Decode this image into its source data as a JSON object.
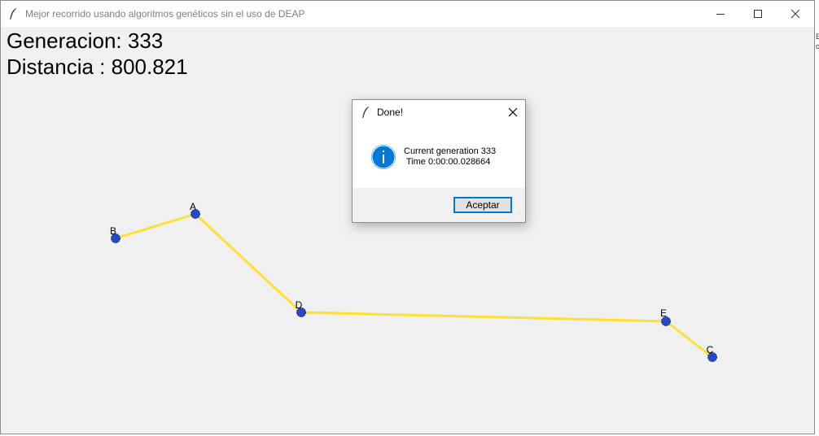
{
  "window": {
    "title": "Mejor recorrido usando algoritmos genéticos sin el uso de DEAP",
    "icon": "feather-icon",
    "controls": [
      "minimize-icon",
      "maximize-icon",
      "close-icon"
    ]
  },
  "stats": {
    "generation_label": "Generacion: 333",
    "distance_label": "Distancia : 800.821"
  },
  "route": {
    "line_color": "#ffe030",
    "node_color": "#2648c4",
    "order": [
      "B",
      "A",
      "D",
      "E",
      "C"
    ],
    "nodes": [
      {
        "label": "B"
      },
      {
        "label": "A"
      },
      {
        "label": "D"
      },
      {
        "label": "E"
      },
      {
        "label": "C"
      }
    ]
  },
  "dialog": {
    "title": "Done!",
    "icon": "info-icon",
    "accent": "#0078d7",
    "message_line1": "Current generation 333",
    "message_line2": " Time 0:00:00.028664",
    "button_label": "Aceptar"
  },
  "side_fragment": {
    "line1": "E",
    "line2": "c"
  }
}
